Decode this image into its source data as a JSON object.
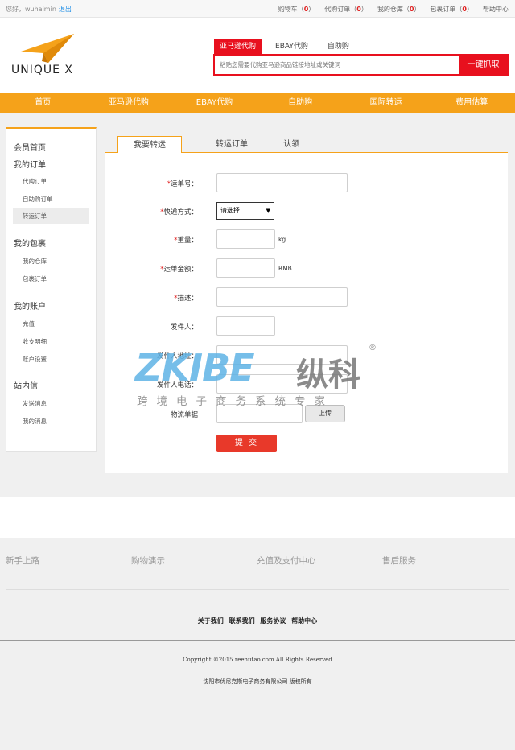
{
  "topbar": {
    "greeting": "您好，",
    "username": "wuhaimin",
    "logout": "退出",
    "links": [
      {
        "label": "购物车",
        "count": "0"
      },
      {
        "label": "代购订单",
        "count": "0"
      },
      {
        "label": "我的仓库",
        "count": "0"
      },
      {
        "label": "包裹订单",
        "count": "0"
      }
    ],
    "help": "帮助中心"
  },
  "header": {
    "logo_text": "UNIQUE X",
    "search_tabs": [
      "亚马逊代购",
      "EBAY代购",
      "自助购"
    ],
    "search_placeholder": "粘贴您需要代购亚马逊商品链接地址或关键词",
    "search_button": "一键抓取"
  },
  "nav": [
    "首页",
    "亚马逊代购",
    "EBAY代购",
    "自助购",
    "国际转运",
    "费用估算"
  ],
  "sidebar": {
    "home": "会员首页",
    "orders_title": "我的订单",
    "orders": [
      "代购订单",
      "自助购订单",
      "转运订单"
    ],
    "packages_title": "我的包裹",
    "packages": [
      "我的仓库",
      "包裹订单"
    ],
    "account_title": "我的账户",
    "account": [
      "充值",
      "收支明细",
      "账户设置"
    ],
    "messages_title": "站内信",
    "messages": [
      "发送消息",
      "我的消息"
    ]
  },
  "tabs": [
    "我要转运",
    "转运订单",
    "认领"
  ],
  "form": {
    "tracking_label": "运单号：",
    "express_label": "快递方式：",
    "express_value": "请选择",
    "weight_label": "重量：",
    "weight_unit": "kg",
    "amount_label": "运单金额：",
    "amount_unit": "RMB",
    "desc_label": "描述：",
    "sender_label": "发件人：",
    "sender_addr_label": "发件人地址：",
    "sender_phone_label": "发件人电话：",
    "waybill_label": "物流单据",
    "upload_button": "上传",
    "submit_button": "提 交"
  },
  "watermark": {
    "main": "ZKIBE",
    "cn": "纵科",
    "registered": "®",
    "sub": "跨境电子商务系统专家"
  },
  "footer": {
    "columns": [
      "新手上路",
      "购物演示",
      "充值及支付中心",
      "售后服务"
    ],
    "links": [
      "关于我们",
      "联系我们",
      "服务协议",
      "帮助中心"
    ],
    "copyright": "Copyright ©2015 reenutao.com All Rights Reserved",
    "company": "沈阳市优尼克斯电子商务有限公司 版权所有"
  },
  "colors": {
    "accent": "#f5a21a",
    "brand_red": "#e8101e",
    "submit_red": "#e8392a",
    "link_blue": "#1d8de6"
  }
}
